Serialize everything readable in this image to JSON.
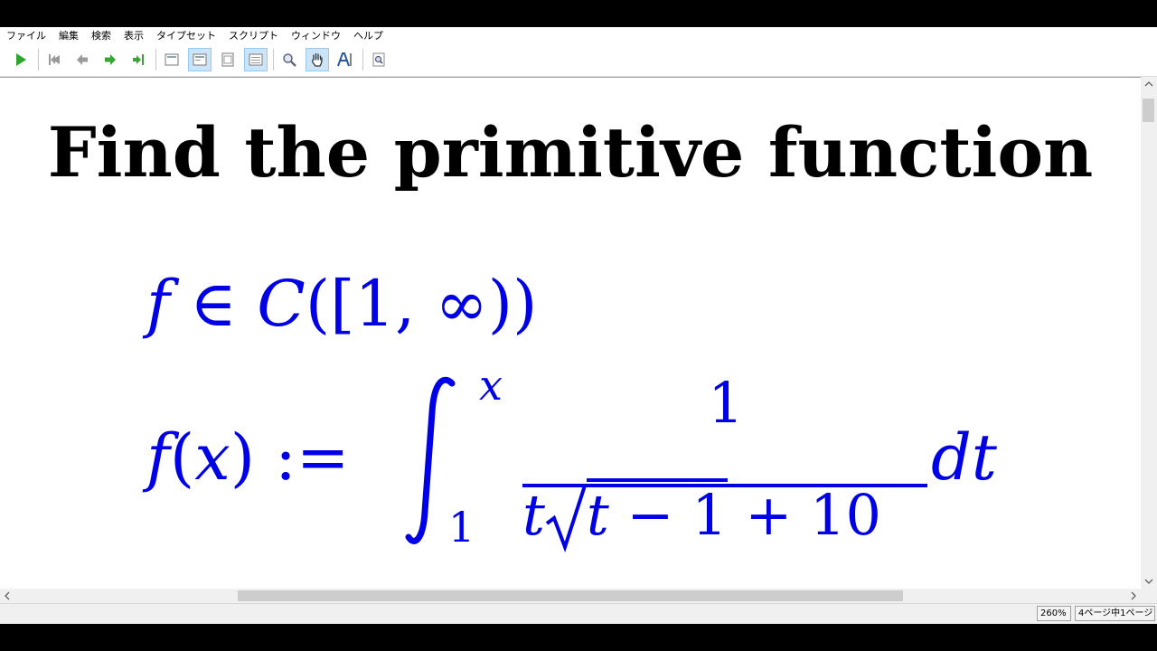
{
  "menu": {
    "items": [
      "ファイル",
      "編集",
      "検索",
      "表示",
      "タイプセット",
      "スクリプト",
      "ウィンドウ",
      "ヘルプ"
    ]
  },
  "toolbar": {
    "buttons": [
      {
        "name": "typeset-run-button",
        "icon": "play-icon"
      },
      {
        "name": "first-page-button",
        "icon": "first-page-icon"
      },
      {
        "name": "previous-page-button",
        "icon": "arrow-left-icon"
      },
      {
        "name": "next-page-button",
        "icon": "arrow-right-icon"
      },
      {
        "name": "last-page-button",
        "icon": "last-page-icon"
      },
      {
        "name": "view-actual-size-button",
        "icon": "page-icon"
      },
      {
        "name": "view-fit-width-button",
        "icon": "page-width-icon",
        "active": true
      },
      {
        "name": "view-fit-page-button",
        "icon": "page-fit-icon"
      },
      {
        "name": "view-fit-window-button",
        "icon": "window-fit-icon",
        "active": true
      },
      {
        "name": "magnify-tool-button",
        "icon": "magnifier-icon"
      },
      {
        "name": "scroll-tool-button",
        "icon": "hand-icon",
        "active": true
      },
      {
        "name": "select-text-tool-button",
        "icon": "text-select-icon"
      },
      {
        "name": "find-button",
        "icon": "find-in-page-icon"
      }
    ],
    "colors": {
      "play": "#2fa52f",
      "arrow": "#3aa336",
      "gray": "#9a9a9a"
    }
  },
  "document": {
    "heading": "Find the primitive function",
    "math": {
      "line1": {
        "f": "f",
        "in": " ∈ ",
        "C": "C",
        "open": "([1, ",
        "inf": "∞",
        "close": "))"
      },
      "line2": {
        "f": "f",
        "lparen": "(",
        "x": "x",
        "rparen": ")",
        "defeq": " :=",
        "upper": "x",
        "lower": "1",
        "numerator": "1",
        "den_t": "t",
        "den_rad_t": "t",
        "den_rad_rest": " − 1",
        "den_tail": " + 10",
        "dt": "dt"
      }
    },
    "math_color": "#0000e6"
  },
  "status": {
    "zoom": "260%",
    "page_info": "4ページ中1ページ"
  }
}
